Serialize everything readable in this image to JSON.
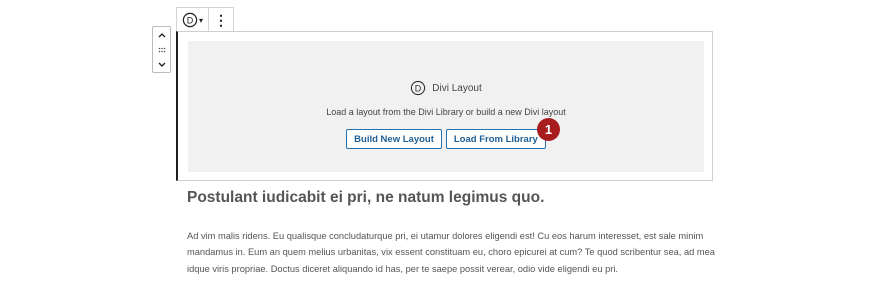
{
  "toolbar": {
    "switcher_letter": "D",
    "chevron": "▾",
    "more": "⋮"
  },
  "mover": {
    "up": "⌃",
    "drag": "⠿",
    "down": "⌄"
  },
  "placeholder": {
    "logo_letter": "D",
    "title": "Divi Layout",
    "description": "Load a layout from the Divi Library or build a new Divi layout",
    "build_button": "Build New Layout",
    "load_button": "Load From Library"
  },
  "annotation": {
    "step": "1",
    "color": "#a71c1c"
  },
  "post": {
    "heading": "Postulant iudicabit ei pri, ne natum legimus quo.",
    "body": "Ad vim malis ridens. Eu qualisque concludaturque pri, ei utamur dolores eligendi est! Cu eos harum interesset, est sale minim mandamus in. Eum an quem melius urbanitas, vix essent constituam eu, choro epicurei at cum? Te quod scribentur sea, ad mea idque viris propriae. Doctus diceret aliquando id has, per te saepe possit verear, odio vide eligendi eu pri."
  },
  "colors": {
    "accent": "#2271b1",
    "placeholder_bg": "#f1f1f1"
  }
}
